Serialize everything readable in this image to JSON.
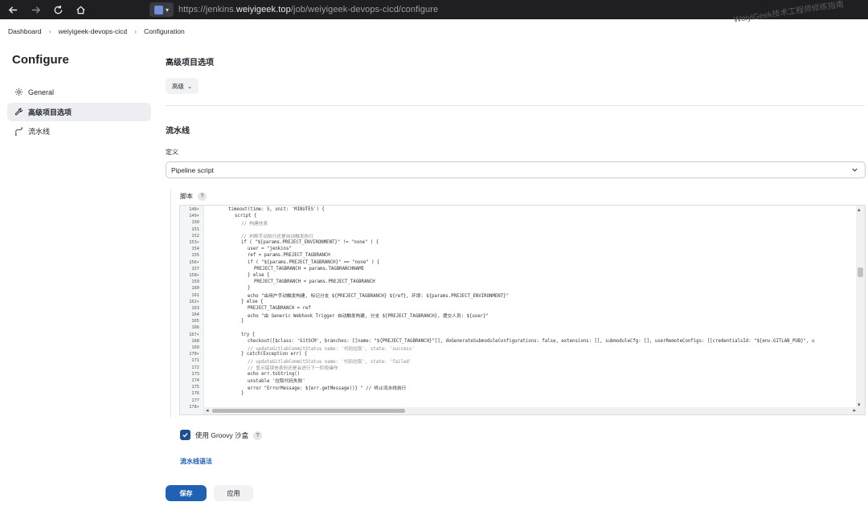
{
  "browser": {
    "url_prefix": "https://jenkins.",
    "url_host": "weiyigeek.top",
    "url_path": "/job/weiyigeek-devops-cicd/configure",
    "watermark": "WeiyiGeek技术工程师修练指南"
  },
  "breadcrumb": [
    "Dashboard",
    "weiyigeek-devops-cicd",
    "Configuration"
  ],
  "sidebar": {
    "title": "Configure",
    "items": [
      {
        "label": "General",
        "icon": "gear-icon",
        "active": false
      },
      {
        "label": "高级项目选项",
        "icon": "wrench-icon",
        "active": true
      },
      {
        "label": "流水线",
        "icon": "pipeline-icon",
        "active": false
      }
    ]
  },
  "main": {
    "advanced_title": "高级项目选项",
    "advanced_button": "高级",
    "pipeline_title": "流水线",
    "definition_label": "定义",
    "definition_value": "Pipeline script",
    "script_label": "脚本",
    "help": "?",
    "sandbox_label": "使用 Groovy 沙盒",
    "sandbox_checked": true,
    "syntax_link": "流水线语法",
    "save": "保存",
    "apply": "应用"
  },
  "editor": {
    "lines": [
      {
        "n": "148",
        "fold": true,
        "indent": 3,
        "text": "timeout(time: 5, unit: 'MINUTES') {"
      },
      {
        "n": "149",
        "fold": true,
        "indent": 4,
        "text": "script {"
      },
      {
        "n": "150",
        "fold": false,
        "indent": 5,
        "text": "// 构建信息",
        "cls": "c-com"
      },
      {
        "n": "151",
        "fold": false,
        "indent": 0,
        "text": ""
      },
      {
        "n": "152",
        "fold": false,
        "indent": 5,
        "text": "// 判断手动执行还是自动触发执行",
        "cls": "c-com"
      },
      {
        "n": "153",
        "fold": true,
        "indent": 5,
        "text": "if ( \"${params.PREJECT_ENVIRONMENT}\" != \"none\" ) {"
      },
      {
        "n": "154",
        "fold": false,
        "indent": 6,
        "text": "user = \"jenkins\""
      },
      {
        "n": "155",
        "fold": false,
        "indent": 6,
        "text": "ref = params.PREJECT_TAGBRANCH"
      },
      {
        "n": "156",
        "fold": true,
        "indent": 6,
        "text": "if ( \"${params.PREJECT_TAGBRANCH}\" == \"none\" ) {"
      },
      {
        "n": "157",
        "fold": false,
        "indent": 7,
        "text": "PREJECT_TAGBRANCH = params.TAGBRANCHNAME"
      },
      {
        "n": "158",
        "fold": true,
        "indent": 6,
        "text": "} else {"
      },
      {
        "n": "159",
        "fold": false,
        "indent": 7,
        "text": "PREJECT_TAGBRANCH = params.PREJECT_TAGBRANCH"
      },
      {
        "n": "160",
        "fold": false,
        "indent": 6,
        "text": "}"
      },
      {
        "n": "161",
        "fold": false,
        "indent": 6,
        "text": "echo \"由用户手动触发构建, 标记分支 ${PREJECT_TAGBRANCH} ${ref}, 环境: ${params.PREJECT_ENVIRONMENT}\""
      },
      {
        "n": "162",
        "fold": true,
        "indent": 5,
        "text": "} else {"
      },
      {
        "n": "163",
        "fold": false,
        "indent": 6,
        "text": "PREJECT_TAGBRANCH = ref"
      },
      {
        "n": "164",
        "fold": false,
        "indent": 6,
        "text": "echo \"由 Generic Webhook Trigger 自动触发构建, 分支 ${PREJECT_TAGBRANCH}, 提交人员: ${user}\""
      },
      {
        "n": "165",
        "fold": false,
        "indent": 5,
        "text": "}"
      },
      {
        "n": "166",
        "fold": false,
        "indent": 0,
        "text": ""
      },
      {
        "n": "167",
        "fold": true,
        "indent": 5,
        "text": "try {"
      },
      {
        "n": "168",
        "fold": false,
        "indent": 6,
        "text": "checkout([$class: 'GitSCM', branches: [[name: \"${PREJECT_TAGBRANCH}\"]], doGenerateSubmoduleConfigurations: false, extensions: [], submoduleCfg: [], userRemoteConfigs: [[credentialsId: \"${env.GITLAB_PUB}\", u"
      },
      {
        "n": "169",
        "fold": false,
        "indent": 6,
        "text": "// updateGitlabCommitStatus name: '代码拉取', state: 'success'",
        "cls": "c-com"
      },
      {
        "n": "170",
        "fold": true,
        "indent": 5,
        "text": "} catch(Exception err) {"
      },
      {
        "n": "171",
        "fold": false,
        "indent": 6,
        "text": "// updateGitlabCommitStatus name: '代码拉取', state: 'failed'",
        "cls": "c-com"
      },
      {
        "n": "172",
        "fold": false,
        "indent": 6,
        "text": "// 显示错误信息但还是会进行下一阶段操作",
        "cls": "c-com"
      },
      {
        "n": "173",
        "fold": false,
        "indent": 6,
        "text": "echo err.toString()"
      },
      {
        "n": "174",
        "fold": false,
        "indent": 6,
        "text": "unstable '拉取代码失败'"
      },
      {
        "n": "175",
        "fold": false,
        "indent": 6,
        "text": "error \"ErrorMessage: ${err.getMessage()} \" // 终止流水线执行"
      },
      {
        "n": "176",
        "fold": false,
        "indent": 5,
        "text": "}"
      },
      {
        "n": "177",
        "fold": false,
        "indent": 0,
        "text": ""
      },
      {
        "n": "178",
        "fold": true,
        "indent": 0,
        "text": ""
      }
    ]
  }
}
